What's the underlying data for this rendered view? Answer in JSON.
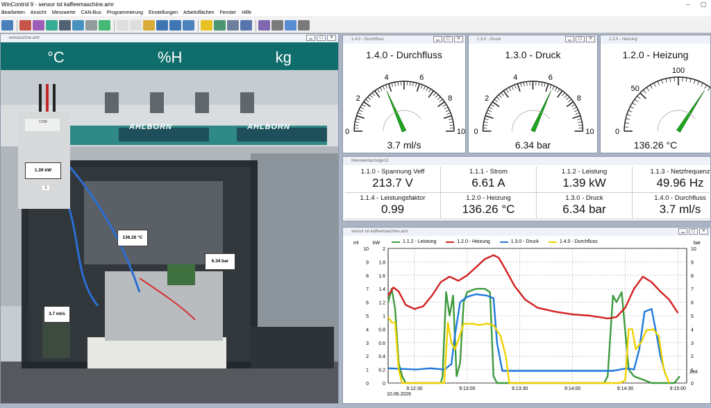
{
  "app": {
    "title": "WinControl 9 - sensor tst kaffeemaschine.amr",
    "window_buttons": [
      "–",
      "▢"
    ]
  },
  "menu": [
    "Bearbeiten",
    "Ansicht",
    "Messwerte",
    "CAN-Bus",
    "Programmierung",
    "Einstellungen",
    "Arbeitsflächen",
    "Fenster",
    "Hilfe"
  ],
  "toolbar_icons": [
    "chart-icon",
    "bar-chart-icon",
    "spc-icon",
    "network-icon",
    "table-icon",
    "graph-icon",
    "numeric-icon",
    "image-icon",
    "print-disabled-icon",
    "save-disabled-icon",
    "open-folder-icon",
    "save-icon",
    "save-as-icon",
    "record-icon",
    "bell-icon",
    "gauge-icon",
    "settings-icon",
    "device-icon",
    "scan-icon",
    "print-icon",
    "plug-icon",
    "wand-icon"
  ],
  "photo_window": {
    "title": "eemaschine.amr",
    "units_banner": [
      "°C",
      "%H",
      "kg"
    ],
    "brand": "AHLBORN",
    "tags": {
      "leistung": "1.39 kW",
      "heizung": "136.26 °C",
      "druck": "6.34 bar",
      "durchfluss": "3.7 ml/s"
    },
    "meter_label": "COM",
    "meter_number": "1"
  },
  "gauges": [
    {
      "window_title": "1.4.0 - Durchfluss",
      "title": "1.4.0 - Durchfluss",
      "value_text": "3.7 ml/s",
      "value": 3.7,
      "min": 0,
      "max": 10,
      "ticks": [
        "0",
        "2",
        "4",
        "6",
        "8",
        "10"
      ]
    },
    {
      "window_title": "1.3.0 - Druck",
      "title": "1.3.0 - Druck",
      "value_text": "6.34 bar",
      "value": 6.34,
      "min": 0,
      "max": 10,
      "ticks": [
        "0",
        "2",
        "4",
        "6",
        "8",
        "10"
      ]
    },
    {
      "window_title": "1.2.0 - Heizung",
      "title": "1.2.0 - Heizung",
      "value_text": "136.26 °C",
      "value": 136.26,
      "min": 0,
      "max": 200,
      "ticks": [
        "0",
        "50",
        "100"
      ]
    }
  ],
  "measurement_window": {
    "title": "Messwertanzeige13",
    "cells": [
      {
        "label": "1.1.0 - Spannung Veff",
        "value": "213.7 V"
      },
      {
        "label": "1.1.1 - Strom",
        "value": "6.61 A"
      },
      {
        "label": "1.1.2 - Leistung",
        "value": "1.39 kW"
      },
      {
        "label": "1.1.3 - Netzfrequenz",
        "value": "49.96 Hz"
      },
      {
        "label": "1.1.4 - Leistungsfaktor",
        "value": "0.99"
      },
      {
        "label": "1.2.0 - Heizung",
        "value": "136.26 °C"
      },
      {
        "label": "1.3.0 - Druck",
        "value": "6.34 bar"
      },
      {
        "label": "1.4.0 - Durchfluss",
        "value": "3.7 ml/s"
      }
    ]
  },
  "chart_window": {
    "title": "sensor tst kaffeemaschine.amr"
  },
  "chart_data": {
    "type": "line",
    "title": "",
    "axis_units": {
      "left_outer": "ml",
      "left_inner": "kW",
      "right": "bar",
      "x": "Zeit"
    },
    "x_date": "10.06.2026",
    "x_ticks": [
      "9:12:30",
      "9:13:00",
      "9:13:30",
      "9:14:00",
      "9:14:30",
      "9:15:00"
    ],
    "x_range_seconds": [
      0,
      170
    ],
    "y_left_outer_ticks": [
      "0",
      "1",
      "2",
      "3",
      "4",
      "5",
      "6",
      "7",
      "8",
      "9",
      "10"
    ],
    "y_left_inner_ticks": [
      "0",
      "0.2",
      "0.4",
      "0.6",
      "0.8",
      "1",
      "1.2",
      "1.4",
      "1.6",
      "1.8",
      "2"
    ],
    "y_right_ticks": [
      "0",
      "1",
      "2",
      "3",
      "4",
      "5",
      "6",
      "7",
      "8",
      "9",
      "10"
    ],
    "grid": true,
    "legend_position": "top",
    "series": [
      {
        "name": "1.1.2 - Leistung",
        "color": "#3c9a3c",
        "axis_max": 2,
        "points": [
          [
            0,
            1.2
          ],
          [
            2,
            1.4
          ],
          [
            4,
            1.1
          ],
          [
            6,
            0.3
          ],
          [
            8,
            0.1
          ],
          [
            10,
            0.0
          ],
          [
            30,
            0.0
          ],
          [
            31,
            0.1
          ],
          [
            33,
            1.35
          ],
          [
            35,
            1.0
          ],
          [
            37,
            1.3
          ],
          [
            39,
            0.1
          ],
          [
            41,
            0.3
          ],
          [
            43,
            1.2
          ],
          [
            45,
            1.35
          ],
          [
            50,
            1.4
          ],
          [
            55,
            1.4
          ],
          [
            58,
            1.35
          ],
          [
            60,
            0.1
          ],
          [
            62,
            0.0
          ],
          [
            68,
            0.0
          ],
          [
            75,
            0.0
          ],
          [
            120,
            0.0
          ],
          [
            123,
            0.0
          ],
          [
            125,
            0.1
          ],
          [
            128,
            1.3
          ],
          [
            130,
            1.2
          ],
          [
            133,
            1.35
          ],
          [
            137,
            0.2
          ],
          [
            140,
            0.1
          ],
          [
            150,
            0.0
          ],
          [
            163,
            0.0
          ],
          [
            166,
            0.1
          ]
        ]
      },
      {
        "name": "1.2.0 - Heizung",
        "color": "#d21e1e",
        "axis_max": 10,
        "points": [
          [
            0,
            6.5
          ],
          [
            3,
            7.1
          ],
          [
            6,
            6.8
          ],
          [
            10,
            5.8
          ],
          [
            15,
            5.5
          ],
          [
            20,
            5.7
          ],
          [
            25,
            6.5
          ],
          [
            30,
            7.5
          ],
          [
            35,
            7.9
          ],
          [
            40,
            7.6
          ],
          [
            45,
            8.0
          ],
          [
            50,
            8.6
          ],
          [
            55,
            9.2
          ],
          [
            60,
            9.5
          ],
          [
            63,
            9.3
          ],
          [
            67,
            8.4
          ],
          [
            72,
            7.2
          ],
          [
            78,
            6.2
          ],
          [
            85,
            5.6
          ],
          [
            95,
            5.3
          ],
          [
            105,
            5.1
          ],
          [
            115,
            5.0
          ],
          [
            125,
            4.8
          ],
          [
            130,
            4.9
          ],
          [
            135,
            5.6
          ],
          [
            140,
            7.0
          ],
          [
            145,
            7.9
          ],
          [
            150,
            7.5
          ],
          [
            155,
            6.8
          ],
          [
            160,
            6.2
          ],
          [
            165,
            5.2
          ]
        ]
      },
      {
        "name": "1.3.0 - Druck",
        "color": "#1e78dc",
        "axis_max": 10,
        "points": [
          [
            0,
            1.1
          ],
          [
            8,
            1.05
          ],
          [
            16,
            1.0
          ],
          [
            24,
            1.1
          ],
          [
            32,
            1.0
          ],
          [
            36,
            1.4
          ],
          [
            38,
            3.5
          ],
          [
            41,
            6.0
          ],
          [
            45,
            6.4
          ],
          [
            50,
            6.6
          ],
          [
            56,
            6.5
          ],
          [
            60,
            6.3
          ],
          [
            62,
            3.0
          ],
          [
            65,
            0.9
          ],
          [
            70,
            0.9
          ],
          [
            100,
            0.9
          ],
          [
            122,
            0.9
          ],
          [
            128,
            0.9
          ],
          [
            132,
            1.0
          ],
          [
            136,
            1.1
          ],
          [
            140,
            1.0
          ],
          [
            143,
            2.5
          ],
          [
            146,
            5.3
          ],
          [
            150,
            5.5
          ],
          [
            153,
            3.5
          ],
          [
            155,
            2.0
          ],
          [
            158,
            0.6
          ]
        ]
      },
      {
        "name": "1.4.0 - Durchfluss",
        "color": "#f0d200",
        "axis_max": 10,
        "points": [
          [
            0,
            4.9
          ],
          [
            2,
            4.5
          ],
          [
            4,
            4.5
          ],
          [
            6,
            1.0
          ],
          [
            8,
            0.0
          ],
          [
            30,
            0.0
          ],
          [
            32,
            0.0
          ],
          [
            34,
            4.5
          ],
          [
            36,
            3.0
          ],
          [
            38,
            2.5
          ],
          [
            40,
            3.2
          ],
          [
            43,
            4.4
          ],
          [
            48,
            4.4
          ],
          [
            52,
            4.3
          ],
          [
            56,
            4.4
          ],
          [
            60,
            4.3
          ],
          [
            64,
            3.5
          ],
          [
            67,
            2.0
          ],
          [
            69,
            0.0
          ],
          [
            75,
            0.0
          ],
          [
            120,
            0.0
          ],
          [
            132,
            0.0
          ],
          [
            135,
            0.2
          ],
          [
            137,
            4.0
          ],
          [
            139,
            4.0
          ],
          [
            141,
            2.5
          ],
          [
            144,
            3.0
          ],
          [
            147,
            3.9
          ],
          [
            151,
            4.0
          ],
          [
            154,
            3.5
          ],
          [
            157,
            1.0
          ],
          [
            160,
            0.0
          ]
        ]
      }
    ]
  }
}
